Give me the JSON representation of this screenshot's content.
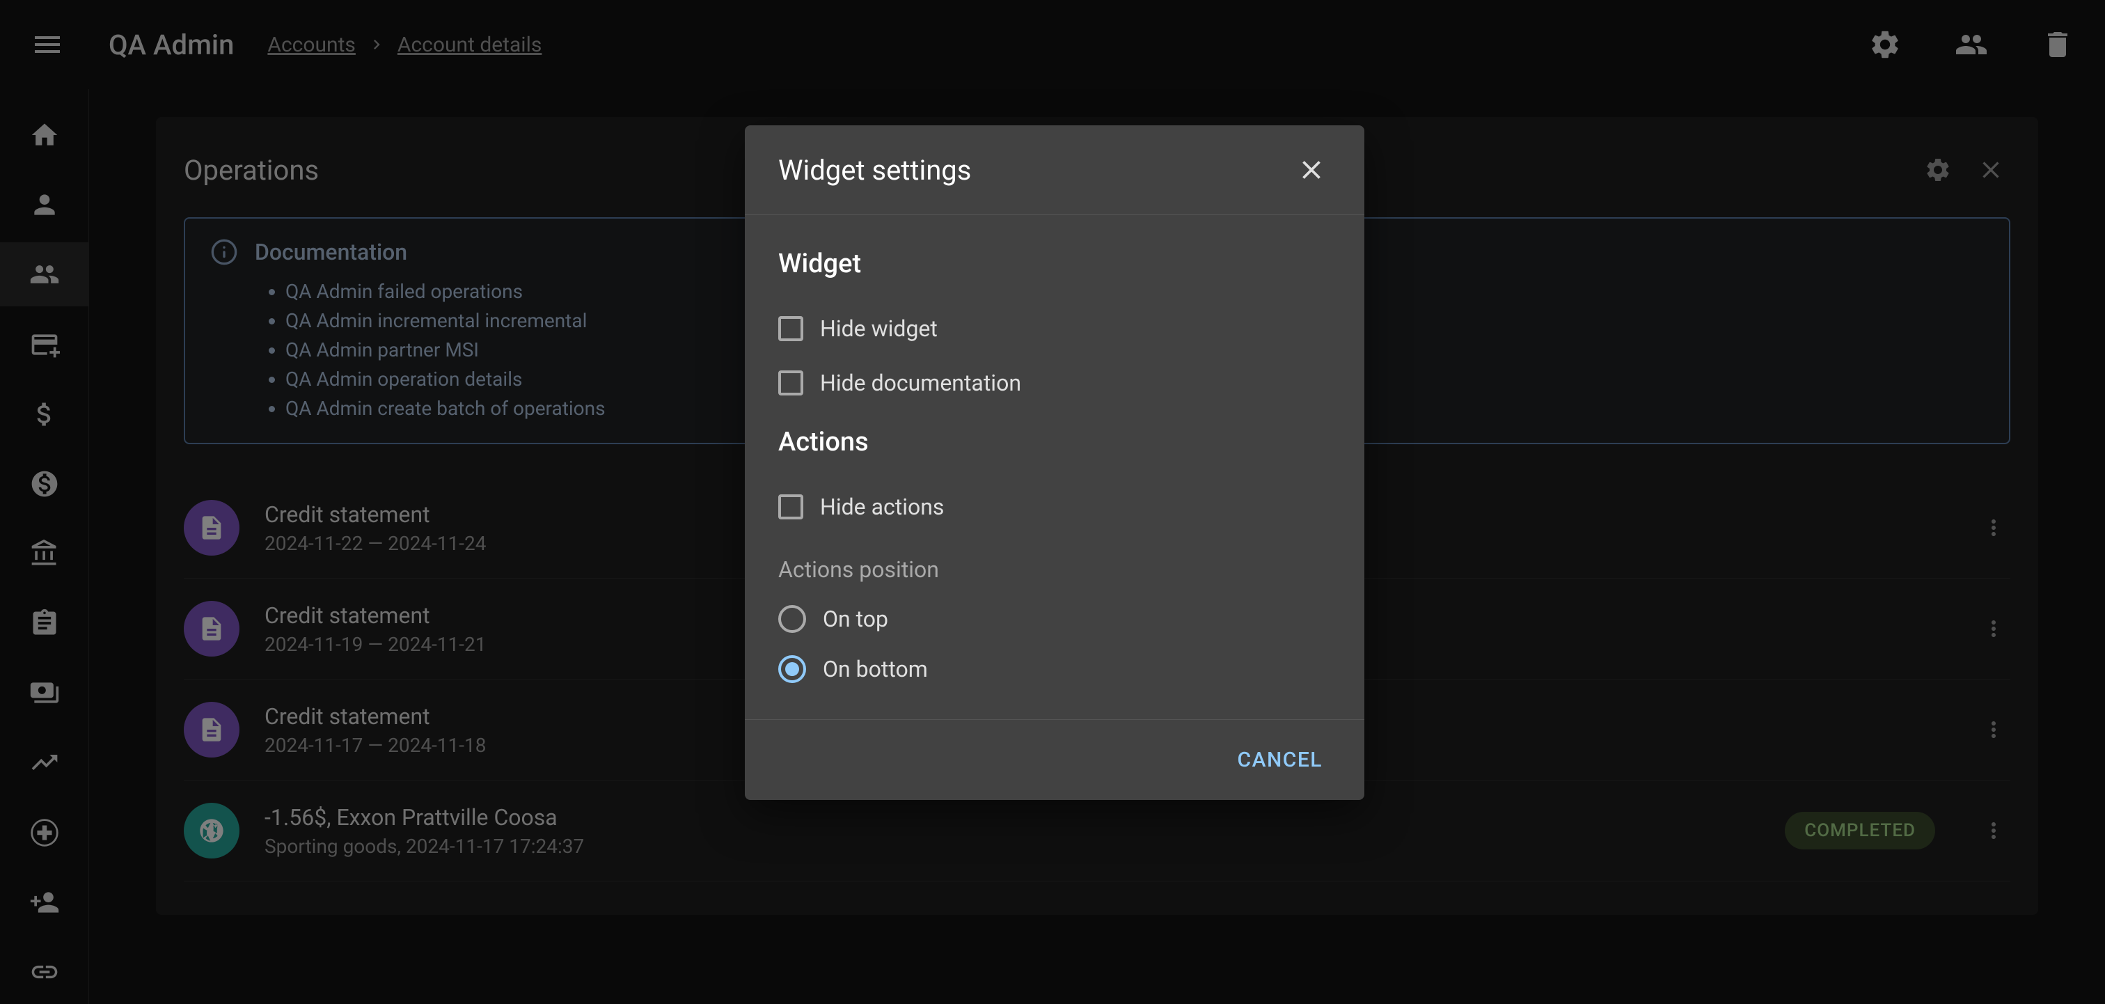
{
  "app_title": "QA Admin",
  "breadcrumb": {
    "items": [
      "Accounts",
      "Account details"
    ]
  },
  "card": {
    "title": "Operations"
  },
  "documentation": {
    "title": "Documentation",
    "items": [
      "QA Admin failed operations",
      "QA Admin incremental incremental",
      "QA Admin partner MSI",
      "QA Admin operation details",
      "QA Admin create batch of operations"
    ]
  },
  "operations": [
    {
      "title": "Credit statement",
      "subtitle": "2024-11-22 — 2024-11-24",
      "avatar": "purple",
      "badge": null
    },
    {
      "title": "Credit statement",
      "subtitle": "2024-11-19 — 2024-11-21",
      "avatar": "purple",
      "badge": null
    },
    {
      "title": "Credit statement",
      "subtitle": "2024-11-17 — 2024-11-18",
      "avatar": "purple",
      "badge": null
    },
    {
      "title": "-1.56$, Exxon Prattville Coosa",
      "subtitle": "Sporting goods, 2024-11-17 17:24:37",
      "avatar": "teal",
      "badge": "COMPLETED"
    }
  ],
  "dialog": {
    "title": "Widget settings",
    "section_widget": "Widget",
    "hide_widget": "Hide widget",
    "hide_documentation": "Hide documentation",
    "section_actions": "Actions",
    "hide_actions": "Hide actions",
    "actions_position_label": "Actions position",
    "on_top": "On top",
    "on_bottom": "On bottom",
    "cancel": "CANCEL",
    "selected_position": "bottom"
  }
}
